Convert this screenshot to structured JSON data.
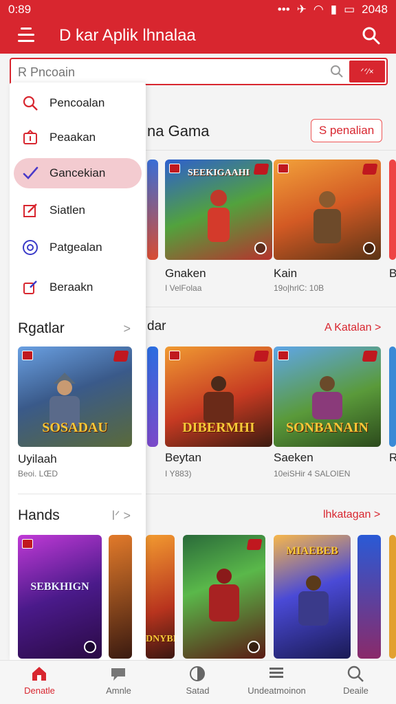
{
  "status_bar": {
    "time": "0:89",
    "right_text": "2048"
  },
  "app": {
    "title": "D kar Aplik lhnalaa"
  },
  "search": {
    "placeholder": "R Pncoain",
    "clear_label": "ᐟᐟ⁄×"
  },
  "drawer": {
    "menu": [
      {
        "label": "Pencoalan",
        "icon": "search-icon",
        "selected": false
      },
      {
        "label": "Peaakan",
        "icon": "box-icon",
        "selected": false
      },
      {
        "label": "Gancekian",
        "icon": "check-icon",
        "selected": true
      },
      {
        "label": "Siatlen",
        "icon": "edit-icon",
        "selected": false
      },
      {
        "label": "Patgealan",
        "icon": "target-icon",
        "selected": false
      },
      {
        "label": "Beraakn",
        "icon": "puzzle-icon",
        "selected": false
      }
    ],
    "sections": [
      {
        "title": "Rgatlar",
        "chevron": ">",
        "item": {
          "title": "Uyilaah",
          "sub": "Beoi. LŒD",
          "banner": "SOSADAU"
        }
      },
      {
        "title": "Hands",
        "chevron": "lᐟ >",
        "item": {
          "banner": "SEBKHIGN"
        }
      }
    ]
  },
  "main": {
    "section1": {
      "title": "na Gama",
      "pill": "S penalian",
      "cards": [
        {
          "title": "Gnaken",
          "sub": "I VelFolaa",
          "banner": "SEEKIGAAHI"
        },
        {
          "title": "Kain",
          "sub": "19o|hrlC: 10B",
          "banner": ""
        },
        {
          "title": "B"
        }
      ]
    },
    "section2": {
      "title": "dar",
      "more": "A Katalan >",
      "cards": [
        {
          "title": "Beytan",
          "sub": "I Y883)",
          "banner": "DIBERMHI"
        },
        {
          "title": "Saeken",
          "sub": "10eiSHir 4 SALOIEN",
          "banner": "SONBANAIN"
        },
        {
          "title": "R"
        }
      ]
    },
    "section3": {
      "more": "lhkatagan >",
      "cards": [
        {
          "banner": "DNYBNE"
        },
        {
          "banner": ""
        },
        {
          "banner": "MIAEBEB"
        }
      ]
    }
  },
  "bottom_nav": [
    {
      "label": "Denatle",
      "icon": "home-icon",
      "active": true
    },
    {
      "label": "Amnle",
      "icon": "chat-icon",
      "active": false
    },
    {
      "label": "Satad",
      "icon": "half-circle-icon",
      "active": false
    },
    {
      "label": "Undeatmoinon",
      "icon": "layers-icon",
      "active": false
    },
    {
      "label": "Deaile",
      "icon": "search-icon",
      "active": false
    }
  ],
  "colors": {
    "brand": "#d8262f",
    "selected_bg": "#f3cbd0"
  }
}
